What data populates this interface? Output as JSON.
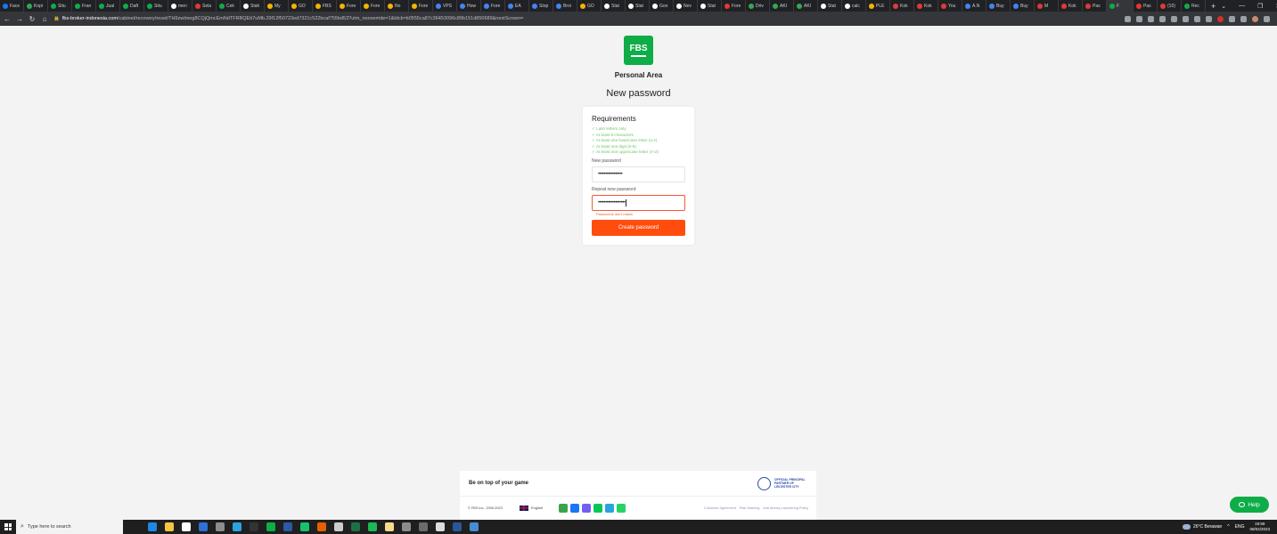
{
  "browser": {
    "tabs": [
      {
        "label": "Face",
        "color": "#1877f2"
      },
      {
        "label": "Kopi",
        "color": "#34a853"
      },
      {
        "label": "Situ",
        "color": "#0ead47"
      },
      {
        "label": "Fran",
        "color": "#0ead47"
      },
      {
        "label": "Jual",
        "color": "#0ead47"
      },
      {
        "label": "Daft",
        "color": "#0ead47"
      },
      {
        "label": "Situ",
        "color": "#0ead47"
      },
      {
        "label": "men",
        "color": "#ffffff"
      },
      {
        "label": "Sela",
        "color": "#e53935"
      },
      {
        "label": "Cek",
        "color": "#0ead47"
      },
      {
        "label": "Stah",
        "color": "#ffffff"
      },
      {
        "label": "My",
        "color": "#f4b400"
      },
      {
        "label": "GO",
        "color": "#f4b400"
      },
      {
        "label": "FBS",
        "color": "#f4b400"
      },
      {
        "label": "Fore",
        "color": "#f4b400"
      },
      {
        "label": "Fore",
        "color": "#f4b400"
      },
      {
        "label": "No",
        "color": "#f4b400"
      },
      {
        "label": "Fore",
        "color": "#f4b400"
      },
      {
        "label": "VPS",
        "color": "#4285f4"
      },
      {
        "label": "How",
        "color": "#4285f4"
      },
      {
        "label": "Fore",
        "color": "#4285f4"
      },
      {
        "label": "EA",
        "color": "#4285f4"
      },
      {
        "label": "Stop",
        "color": "#4285f4"
      },
      {
        "label": "Broi",
        "color": "#4285f4"
      },
      {
        "label": "GO",
        "color": "#f4b400"
      },
      {
        "label": "Stat",
        "color": "#ffffff"
      },
      {
        "label": "Stat",
        "color": "#ffffff"
      },
      {
        "label": "Goo",
        "color": "#ffffff"
      },
      {
        "label": "Nev",
        "color": "#ffffff"
      },
      {
        "label": "Stat",
        "color": "#ffffff"
      },
      {
        "label": "Fore",
        "color": "#e53935"
      },
      {
        "label": "Driv",
        "color": "#34a853"
      },
      {
        "label": "AKI",
        "color": "#34a853"
      },
      {
        "label": "AKI",
        "color": "#34a853"
      },
      {
        "label": "Stat",
        "color": "#ffffff"
      },
      {
        "label": "calc",
        "color": "#ffffff"
      },
      {
        "label": "PLE",
        "color": "#f4b400"
      },
      {
        "label": "Kok",
        "color": "#e53935"
      },
      {
        "label": "Kok",
        "color": "#e53935"
      },
      {
        "label": "You",
        "color": "#e53935"
      },
      {
        "label": "A.N",
        "color": "#4285f4"
      },
      {
        "label": "Buy",
        "color": "#4285f4"
      },
      {
        "label": "Buy",
        "color": "#4285f4"
      },
      {
        "label": "M",
        "color": "#e53935"
      },
      {
        "label": "Kok",
        "color": "#e53935"
      },
      {
        "label": "Pas",
        "color": "#e53935"
      },
      {
        "label": "F",
        "color": "#0ead47",
        "active": true
      },
      {
        "label": "Pas",
        "color": "#e53935"
      },
      {
        "label": "(10)",
        "color": "#e53935"
      },
      {
        "label": "Rec",
        "color": "#0ead47"
      }
    ],
    "new_tab": "+",
    "window_controls": [
      "⌄",
      "—",
      "❐",
      "✕"
    ],
    "nav": {
      "back": "←",
      "forward": "→",
      "reload": "↻",
      "home": "⌂"
    },
    "url_domain": "fbs-broker-indonesia.com",
    "url_path": "/cabinet/recovery/reset/TH9zwImeg8CQjQmcEmNdTFRBQEtt7uMb.29f12f50723ed7321c522bcaf755bd53?utm_nooverride=1&tdck=b0555ca87c36453096c89b151d850689&nextScreen="
  },
  "page": {
    "logo_text": "FBS",
    "brand_subtitle": "Personal Area",
    "title": "New password",
    "requirements": {
      "title": "Requirements",
      "items": [
        "Latin letters only",
        "At least 8 characters",
        "At least one lowercase letter (a-z)",
        "At least one digit (0-9)",
        "At least one uppercase letter (A-Z)"
      ],
      "color": "#74c36a"
    },
    "new_password": {
      "label": "New password",
      "value": "•••••••••••••••••"
    },
    "repeat_password": {
      "label": "Repeat new password",
      "value": "•••••••••••••••••••",
      "error": "Passwords don't match"
    },
    "submit_label": "Create password",
    "accent_orange": "#ff4d0d",
    "brand_green": "#0ead47"
  },
  "footer": {
    "tagline": "Be on top of your game",
    "partner_text": "OFFICIAL PRINCIPAL PARTNER OF LEICESTER CITY",
    "copyright": "© FBS Inc., 2009-2023",
    "language": "English",
    "socials": [
      {
        "name": "fbs-app",
        "color": "#3aa34a"
      },
      {
        "name": "messenger",
        "color": "#1877f2"
      },
      {
        "name": "viber",
        "color": "#7360f2"
      },
      {
        "name": "line",
        "color": "#06c755"
      },
      {
        "name": "telegram",
        "color": "#2aa3df"
      },
      {
        "name": "whatsapp",
        "color": "#25d366"
      }
    ],
    "links": [
      "Customer Agreement",
      "Risk Warning",
      "Anti-Money-Laundering Policy"
    ]
  },
  "help_label": "Help",
  "taskbar": {
    "search_placeholder": "Type here to search",
    "apps": [
      {
        "name": "edge",
        "color": "#1e88e5"
      },
      {
        "name": "file-explorer",
        "color": "#f4c542"
      },
      {
        "name": "store",
        "color": "#ffffff"
      },
      {
        "name": "mail",
        "color": "#2f6fd6"
      },
      {
        "name": "chrome",
        "color": "#8d8d8d"
      },
      {
        "name": "telegram",
        "color": "#2aa3df"
      },
      {
        "name": "terminal",
        "color": "#333333"
      },
      {
        "name": "fbs",
        "color": "#0ead47"
      },
      {
        "name": "metatrader",
        "color": "#2b5aa6"
      },
      {
        "name": "opera-gx",
        "color": "#16c172"
      },
      {
        "name": "firefox",
        "color": "#e66000"
      },
      {
        "name": "browser",
        "color": "#cccccc"
      },
      {
        "name": "excel",
        "color": "#1d7044"
      },
      {
        "name": "spotify",
        "color": "#1db954"
      },
      {
        "name": "notes",
        "color": "#f7d98b"
      },
      {
        "name": "settings",
        "color": "#8c8c8c"
      },
      {
        "name": "app-1",
        "color": "#6b6b6b"
      },
      {
        "name": "app-2",
        "color": "#dddddd"
      },
      {
        "name": "word",
        "color": "#2b579a"
      },
      {
        "name": "app-3",
        "color": "#4a8bd6"
      }
    ],
    "weather": "26°C Berawan",
    "language": "ENG",
    "time": "19:59",
    "date": "08/02/2023"
  }
}
